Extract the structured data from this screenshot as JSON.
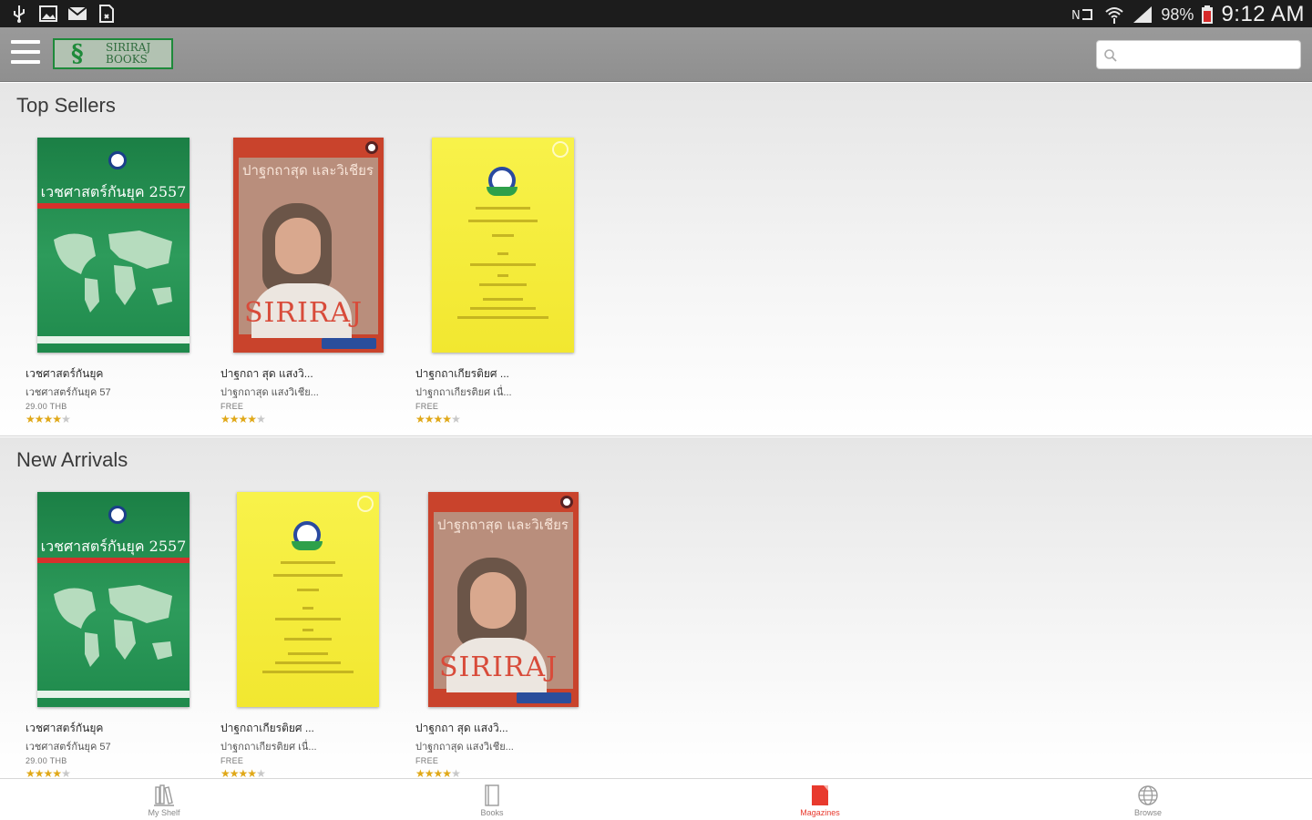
{
  "status_bar": {
    "battery": "98%",
    "time": "9:12 AM"
  },
  "app_bar": {
    "logo_text_line1": "SIRIRAJ",
    "logo_text_line2": "BOOKS",
    "search": {
      "value": "",
      "placeholder": ""
    }
  },
  "sections": [
    {
      "title": "Top Sellers",
      "books": [
        {
          "cover": "green",
          "cover_title": "เวชศาสตร์กันยุค 2557",
          "title": "เวชศาสตร์กันยุค",
          "subtitle": "เวชศาสตร์กันยุค 57",
          "price": "29.00 THB",
          "rating": 4
        },
        {
          "cover": "portrait",
          "cover_title": "ปาฐกถาสุด และวิเชียร",
          "cover_brand": "SIRIRAJ",
          "title": "ปาฐกถา สุด แสงวิ...",
          "subtitle": "ปาฐกถาสุด แสงวิเชีย...",
          "price": "FREE",
          "rating": 4
        },
        {
          "cover": "yellow",
          "title": "ปาฐกถาเกียรติยศ ...",
          "subtitle": "ปาฐกถาเกียรติยศ เนื่...",
          "price": "FREE",
          "rating": 4
        }
      ]
    },
    {
      "title": "New Arrivals",
      "books": [
        {
          "cover": "green",
          "cover_title": "เวชศาสตร์กันยุค 2557",
          "title": "เวชศาสตร์กันยุค",
          "subtitle": "เวชศาสตร์กันยุค 57",
          "price": "29.00 THB",
          "rating": 4
        },
        {
          "cover": "yellow",
          "title": "ปาฐกถาเกียรติยศ ...",
          "subtitle": "ปาฐกถาเกียรติยศ เนื่...",
          "price": "FREE",
          "rating": 4
        },
        {
          "cover": "portrait",
          "cover_title": "ปาฐกถาสุด และวิเชียร",
          "cover_brand": "SIRIRAJ",
          "title": "ปาฐกถา สุด แสงวิ...",
          "subtitle": "ปาฐกถาสุด แสงวิเชีย...",
          "price": "FREE",
          "rating": 4
        }
      ]
    }
  ],
  "bottom_nav": [
    {
      "label": "My Shelf",
      "icon": "shelf-icon",
      "active": false
    },
    {
      "label": "Books",
      "icon": "book-icon",
      "active": false
    },
    {
      "label": "Magazines",
      "icon": "magazine-icon",
      "active": true
    },
    {
      "label": "Browse",
      "icon": "globe-icon",
      "active": false
    }
  ],
  "colors": {
    "accent": "#e83a2e",
    "app_bar": "#959595",
    "star": "#e0a818",
    "logo_green": "#1e8a3a"
  }
}
